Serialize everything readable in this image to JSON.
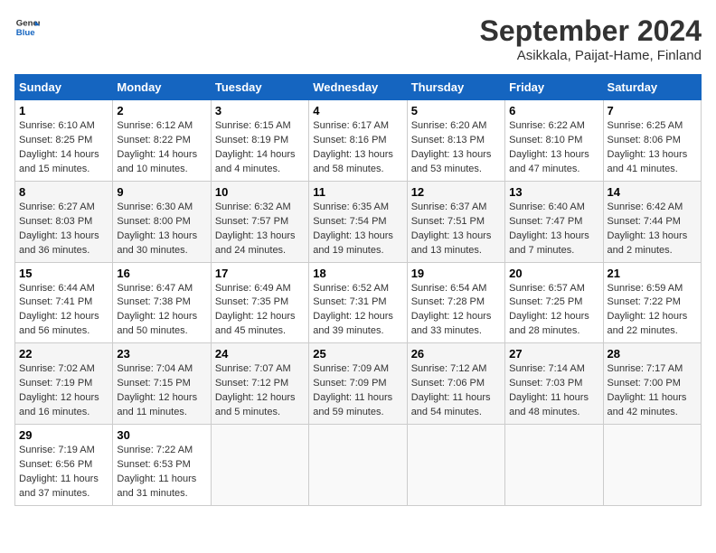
{
  "header": {
    "logo_general": "General",
    "logo_blue": "Blue",
    "title": "September 2024",
    "subtitle": "Asikkala, Paijat-Hame, Finland"
  },
  "weekdays": [
    "Sunday",
    "Monday",
    "Tuesday",
    "Wednesday",
    "Thursday",
    "Friday",
    "Saturday"
  ],
  "weeks": [
    [
      {
        "day": "1",
        "info": "Sunrise: 6:10 AM\nSunset: 8:25 PM\nDaylight: 14 hours\nand 15 minutes."
      },
      {
        "day": "2",
        "info": "Sunrise: 6:12 AM\nSunset: 8:22 PM\nDaylight: 14 hours\nand 10 minutes."
      },
      {
        "day": "3",
        "info": "Sunrise: 6:15 AM\nSunset: 8:19 PM\nDaylight: 14 hours\nand 4 minutes."
      },
      {
        "day": "4",
        "info": "Sunrise: 6:17 AM\nSunset: 8:16 PM\nDaylight: 13 hours\nand 58 minutes."
      },
      {
        "day": "5",
        "info": "Sunrise: 6:20 AM\nSunset: 8:13 PM\nDaylight: 13 hours\nand 53 minutes."
      },
      {
        "day": "6",
        "info": "Sunrise: 6:22 AM\nSunset: 8:10 PM\nDaylight: 13 hours\nand 47 minutes."
      },
      {
        "day": "7",
        "info": "Sunrise: 6:25 AM\nSunset: 8:06 PM\nDaylight: 13 hours\nand 41 minutes."
      }
    ],
    [
      {
        "day": "8",
        "info": "Sunrise: 6:27 AM\nSunset: 8:03 PM\nDaylight: 13 hours\nand 36 minutes."
      },
      {
        "day": "9",
        "info": "Sunrise: 6:30 AM\nSunset: 8:00 PM\nDaylight: 13 hours\nand 30 minutes."
      },
      {
        "day": "10",
        "info": "Sunrise: 6:32 AM\nSunset: 7:57 PM\nDaylight: 13 hours\nand 24 minutes."
      },
      {
        "day": "11",
        "info": "Sunrise: 6:35 AM\nSunset: 7:54 PM\nDaylight: 13 hours\nand 19 minutes."
      },
      {
        "day": "12",
        "info": "Sunrise: 6:37 AM\nSunset: 7:51 PM\nDaylight: 13 hours\nand 13 minutes."
      },
      {
        "day": "13",
        "info": "Sunrise: 6:40 AM\nSunset: 7:47 PM\nDaylight: 13 hours\nand 7 minutes."
      },
      {
        "day": "14",
        "info": "Sunrise: 6:42 AM\nSunset: 7:44 PM\nDaylight: 13 hours\nand 2 minutes."
      }
    ],
    [
      {
        "day": "15",
        "info": "Sunrise: 6:44 AM\nSunset: 7:41 PM\nDaylight: 12 hours\nand 56 minutes."
      },
      {
        "day": "16",
        "info": "Sunrise: 6:47 AM\nSunset: 7:38 PM\nDaylight: 12 hours\nand 50 minutes."
      },
      {
        "day": "17",
        "info": "Sunrise: 6:49 AM\nSunset: 7:35 PM\nDaylight: 12 hours\nand 45 minutes."
      },
      {
        "day": "18",
        "info": "Sunrise: 6:52 AM\nSunset: 7:31 PM\nDaylight: 12 hours\nand 39 minutes."
      },
      {
        "day": "19",
        "info": "Sunrise: 6:54 AM\nSunset: 7:28 PM\nDaylight: 12 hours\nand 33 minutes."
      },
      {
        "day": "20",
        "info": "Sunrise: 6:57 AM\nSunset: 7:25 PM\nDaylight: 12 hours\nand 28 minutes."
      },
      {
        "day": "21",
        "info": "Sunrise: 6:59 AM\nSunset: 7:22 PM\nDaylight: 12 hours\nand 22 minutes."
      }
    ],
    [
      {
        "day": "22",
        "info": "Sunrise: 7:02 AM\nSunset: 7:19 PM\nDaylight: 12 hours\nand 16 minutes."
      },
      {
        "day": "23",
        "info": "Sunrise: 7:04 AM\nSunset: 7:15 PM\nDaylight: 12 hours\nand 11 minutes."
      },
      {
        "day": "24",
        "info": "Sunrise: 7:07 AM\nSunset: 7:12 PM\nDaylight: 12 hours\nand 5 minutes."
      },
      {
        "day": "25",
        "info": "Sunrise: 7:09 AM\nSunset: 7:09 PM\nDaylight: 11 hours\nand 59 minutes."
      },
      {
        "day": "26",
        "info": "Sunrise: 7:12 AM\nSunset: 7:06 PM\nDaylight: 11 hours\nand 54 minutes."
      },
      {
        "day": "27",
        "info": "Sunrise: 7:14 AM\nSunset: 7:03 PM\nDaylight: 11 hours\nand 48 minutes."
      },
      {
        "day": "28",
        "info": "Sunrise: 7:17 AM\nSunset: 7:00 PM\nDaylight: 11 hours\nand 42 minutes."
      }
    ],
    [
      {
        "day": "29",
        "info": "Sunrise: 7:19 AM\nSunset: 6:56 PM\nDaylight: 11 hours\nand 37 minutes."
      },
      {
        "day": "30",
        "info": "Sunrise: 7:22 AM\nSunset: 6:53 PM\nDaylight: 11 hours\nand 31 minutes."
      },
      {
        "day": "",
        "info": ""
      },
      {
        "day": "",
        "info": ""
      },
      {
        "day": "",
        "info": ""
      },
      {
        "day": "",
        "info": ""
      },
      {
        "day": "",
        "info": ""
      }
    ]
  ]
}
